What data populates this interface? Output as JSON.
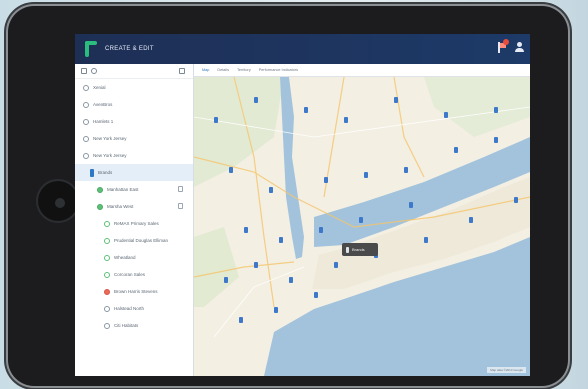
{
  "app": {
    "title": "CREATE & EDIT"
  },
  "header": {
    "notification_count": ""
  },
  "sidebar": {
    "items": [
      {
        "label": "Xenial",
        "icon": "outline",
        "indent": 0
      },
      {
        "label": "AvenBros",
        "icon": "outline",
        "indent": 0
      },
      {
        "label": "Hamlets 1",
        "icon": "outline",
        "indent": 0
      },
      {
        "label": "New York Jersey",
        "icon": "outline",
        "indent": 0
      },
      {
        "label": "New York Jersey",
        "icon": "outline",
        "indent": 0
      },
      {
        "label": "Brands",
        "icon": "blue-bar",
        "indent": 1,
        "selected": true
      },
      {
        "label": "Manhattan East",
        "icon": "green",
        "indent": 2,
        "chevron": true
      },
      {
        "label": "Marsha West",
        "icon": "green",
        "indent": 2,
        "chevron": true
      },
      {
        "label": "ReMAX Primary Sales",
        "icon": "outline-green",
        "indent": 3
      },
      {
        "label": "Prudential Douglas Elliman",
        "icon": "outline-green",
        "indent": 3
      },
      {
        "label": "Wheatland",
        "icon": "outline-green",
        "indent": 3
      },
      {
        "label": "Corcoran Sales",
        "icon": "outline-green",
        "indent": 3
      },
      {
        "label": "Brown Harris Stevens",
        "icon": "red",
        "indent": 3
      },
      {
        "label": "Halstead North",
        "icon": "outline",
        "indent": 3
      },
      {
        "label": "Citi Habitats",
        "icon": "outline",
        "indent": 3
      }
    ]
  },
  "tabs": [
    {
      "label": "Map",
      "active": true
    },
    {
      "label": "Details"
    },
    {
      "label": "Territory"
    },
    {
      "label": "Performance Indicators"
    }
  ],
  "map": {
    "popup_label": "Brands",
    "attribution": "Map data ©2014 Google"
  },
  "colors": {
    "header_bg": "#1e2f55",
    "accent": "#2f78c4",
    "logo": "#2bbd7e",
    "water": "#a3c3dc",
    "land": "#f3efe3"
  }
}
